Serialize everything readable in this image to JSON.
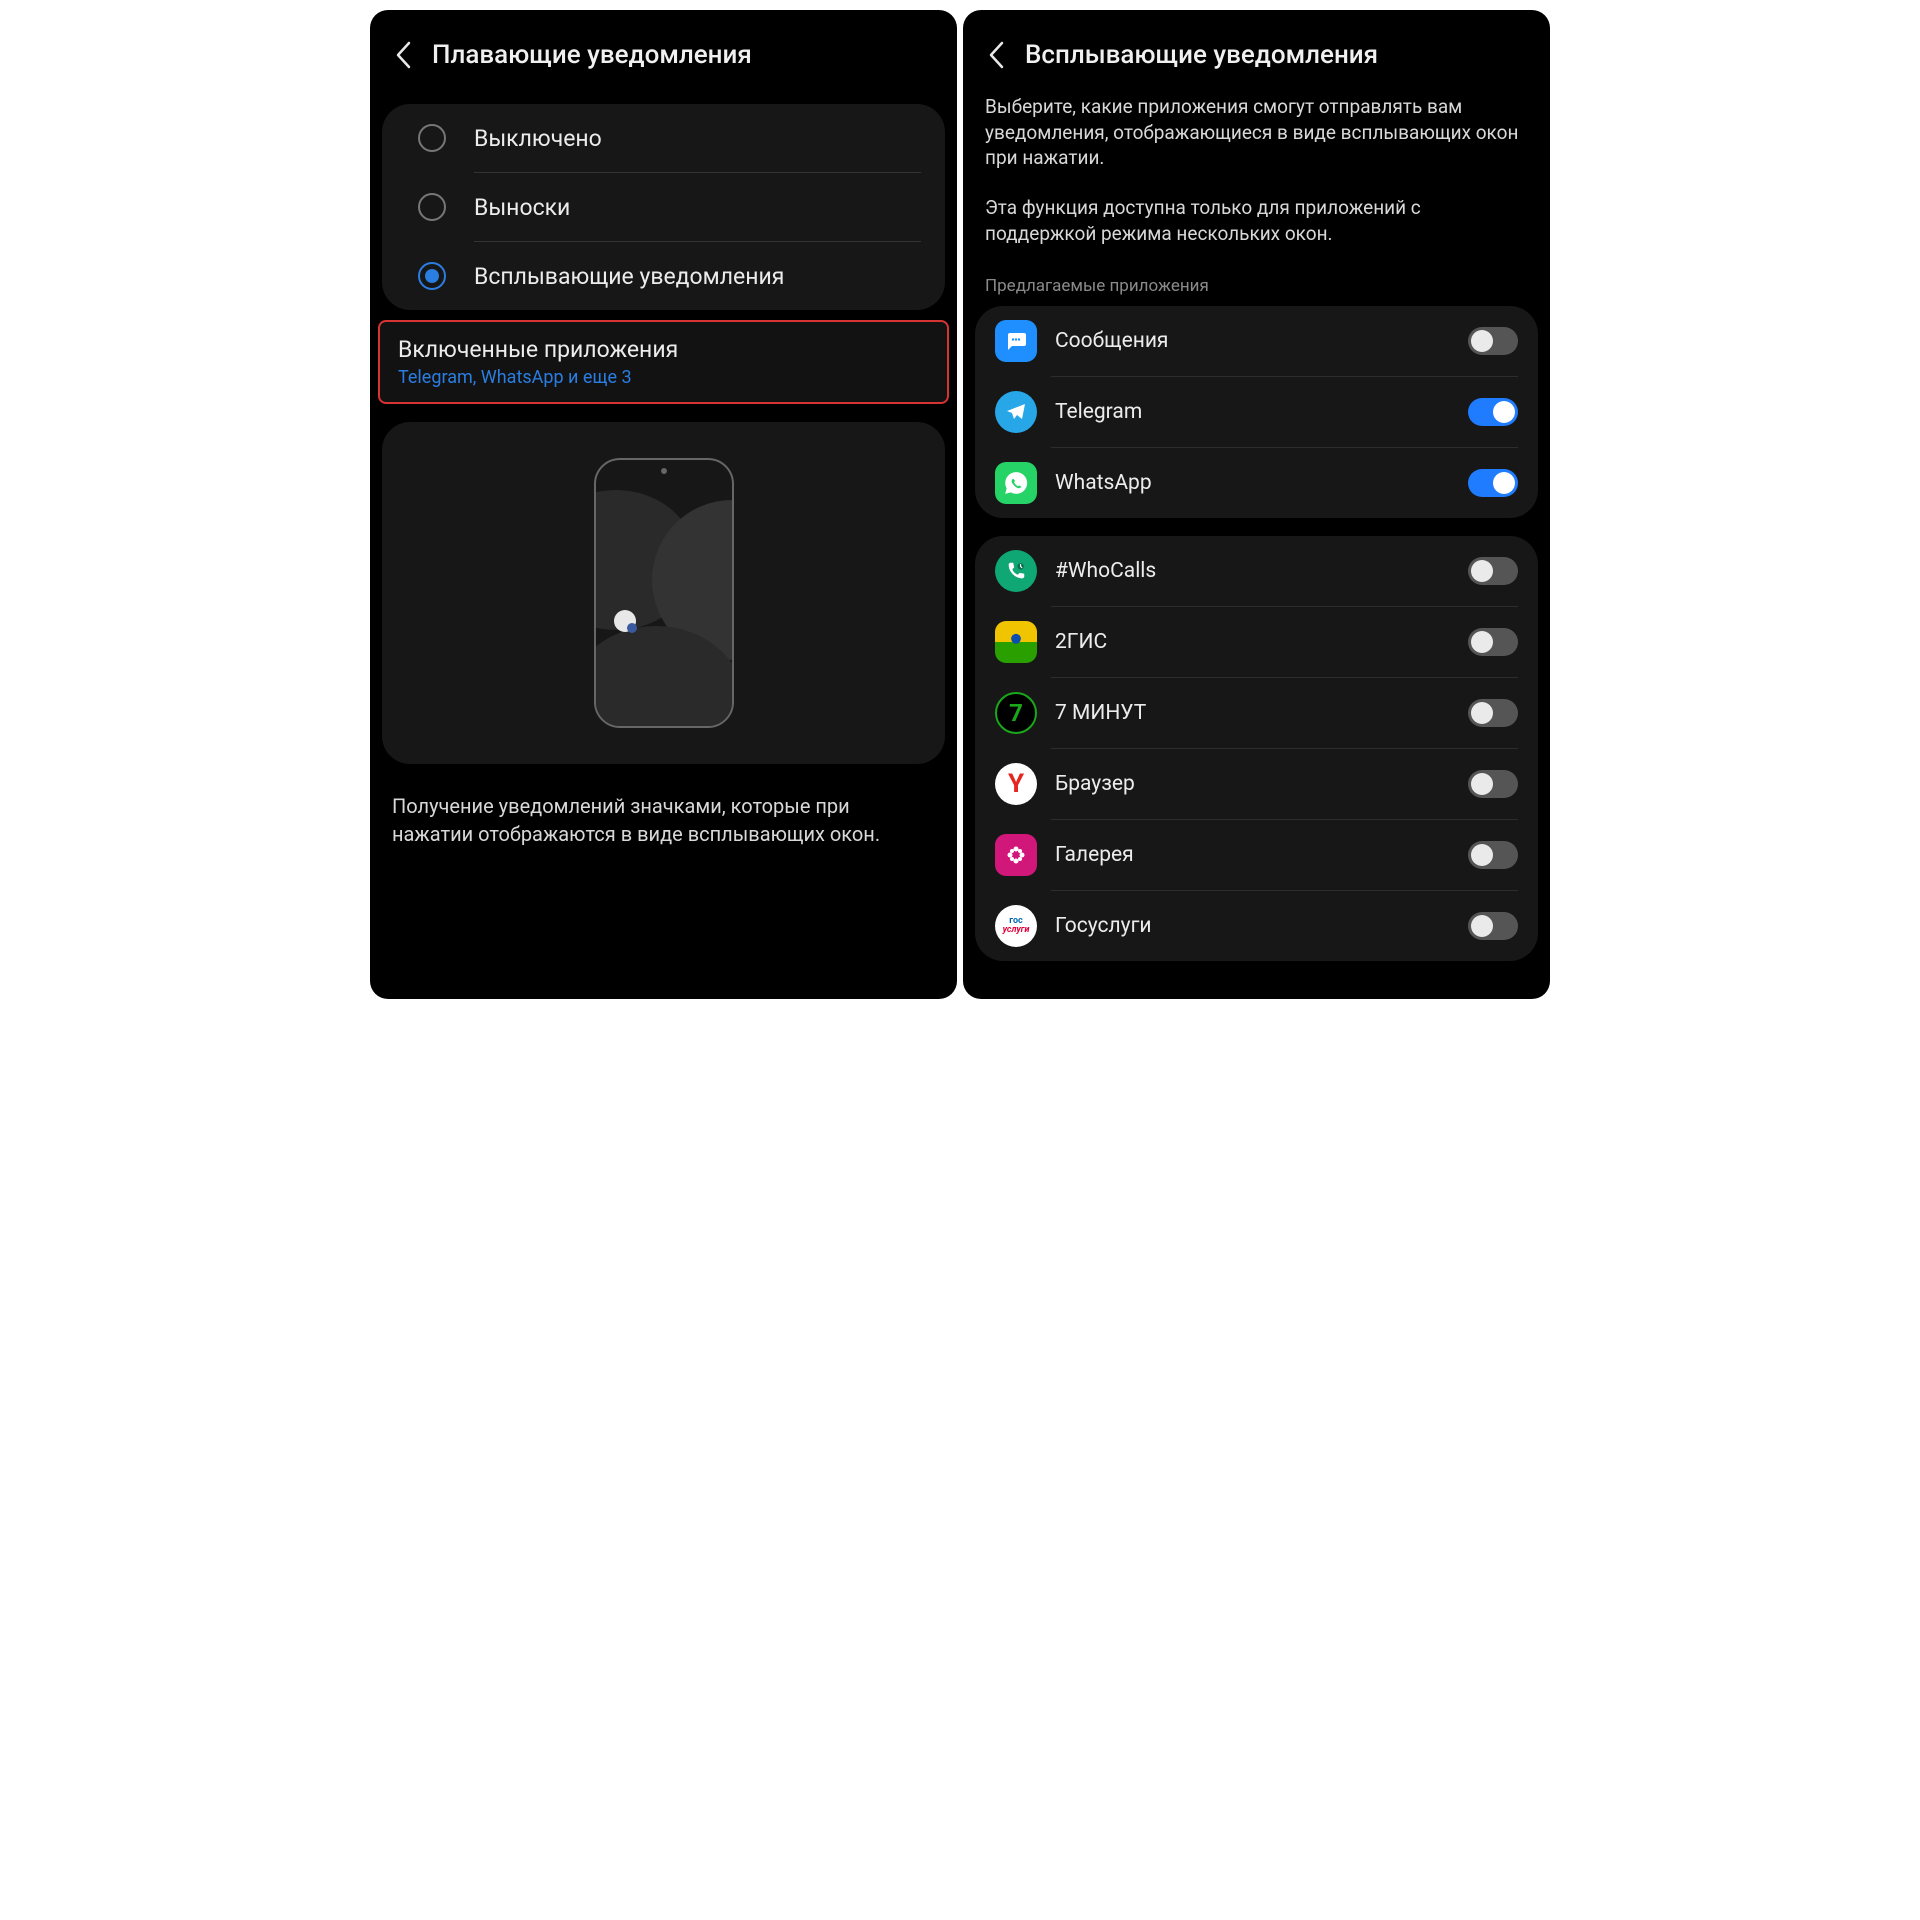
{
  "left": {
    "title": "Плавающие уведомления",
    "radios": [
      {
        "label": "Выключено",
        "selected": false
      },
      {
        "label": "Выноски",
        "selected": false
      },
      {
        "label": "Всплывающие уведомления",
        "selected": true
      }
    ],
    "enabled": {
      "title": "Включенные приложения",
      "subtitle": "Telegram, WhatsApp и еще 3"
    },
    "description": "Получение уведомлений значками, которые при нажатии отображаются в виде всплывающих окон."
  },
  "right": {
    "title": "Всплывающие уведомления",
    "info1": "Выберите, какие приложения смогут отправлять вам уведомления, отображающиеся в виде всплывающих окон при нажатии.",
    "info2": "Эта функция доступна только для приложений с поддержкой режима нескольких окон.",
    "suggested_label": "Предлагаемые приложения",
    "suggested": [
      {
        "name": "Сообщения",
        "icon": "messages",
        "on": false
      },
      {
        "name": "Telegram",
        "icon": "telegram",
        "on": true
      },
      {
        "name": "WhatsApp",
        "icon": "whatsapp",
        "on": true
      }
    ],
    "apps": [
      {
        "name": "#WhoCalls",
        "icon": "whocalls",
        "on": false
      },
      {
        "name": "2ГИС",
        "icon": "2gis",
        "on": false
      },
      {
        "name": "7 МИНУТ",
        "icon": "7min",
        "on": false
      },
      {
        "name": "Браузер",
        "icon": "browser",
        "on": false
      },
      {
        "name": "Галерея",
        "icon": "gallery",
        "on": false
      },
      {
        "name": "Госуслуги",
        "icon": "gosuslugi",
        "on": false
      }
    ]
  }
}
